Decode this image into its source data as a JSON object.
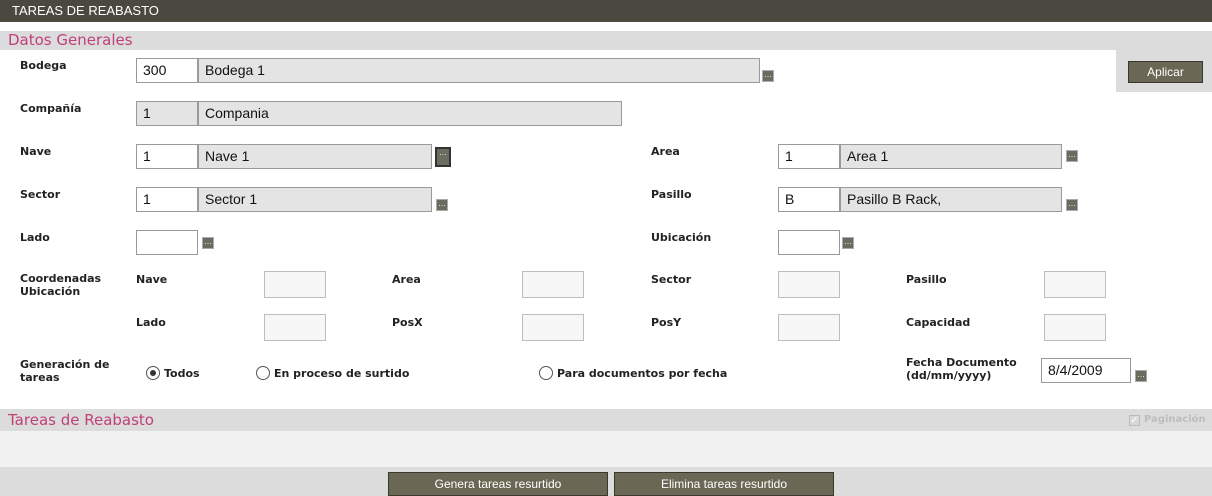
{
  "window": {
    "title": "TAREAS DE REABASTO"
  },
  "datos_generales": {
    "title": "Datos Generales",
    "aplicar_label": "Aplicar",
    "bodega": {
      "label": "Bodega",
      "code": "300",
      "name": "Bodega 1"
    },
    "compania": {
      "label": "Compañía",
      "code": "1",
      "name": "Compania"
    },
    "nave": {
      "label": "Nave",
      "code": "1",
      "name": "Nave 1"
    },
    "area": {
      "label": "Area",
      "code": "1",
      "name": "Area 1"
    },
    "sector": {
      "label": "Sector",
      "code": "1",
      "name": "Sector 1"
    },
    "pasillo": {
      "label": "Pasillo",
      "code": "B",
      "name": "Pasillo B Rack,"
    },
    "lado": {
      "label": "Lado",
      "code": ""
    },
    "ubicacion": {
      "label": "Ubicación",
      "code": ""
    },
    "coordenadas": {
      "label": "Coordenadas Ubicación",
      "row1": {
        "nave": "Nave",
        "area": "Area",
        "sector": "Sector",
        "pasillo": "Pasillo"
      },
      "row2": {
        "lado": "Lado",
        "posx": "PosX",
        "posy": "PosY",
        "capacidad": "Capacidad"
      }
    },
    "generacion": {
      "label": "Generación de tareas",
      "options": [
        "Todos",
        "En proceso de surtido",
        "Para documentos por fecha"
      ],
      "selected": "Todos"
    },
    "fecha_documento": {
      "label": "Fecha Documento (dd/mm/yyyy)",
      "value": "8/4/2009"
    }
  },
  "tareas": {
    "title": "Tareas de Reabasto",
    "paginacion_label": "Paginación",
    "paginacion_checked": true
  },
  "footer": {
    "genera_label": "Genera tareas resurtido",
    "elimina_label": "Elimina tareas resurtido"
  }
}
